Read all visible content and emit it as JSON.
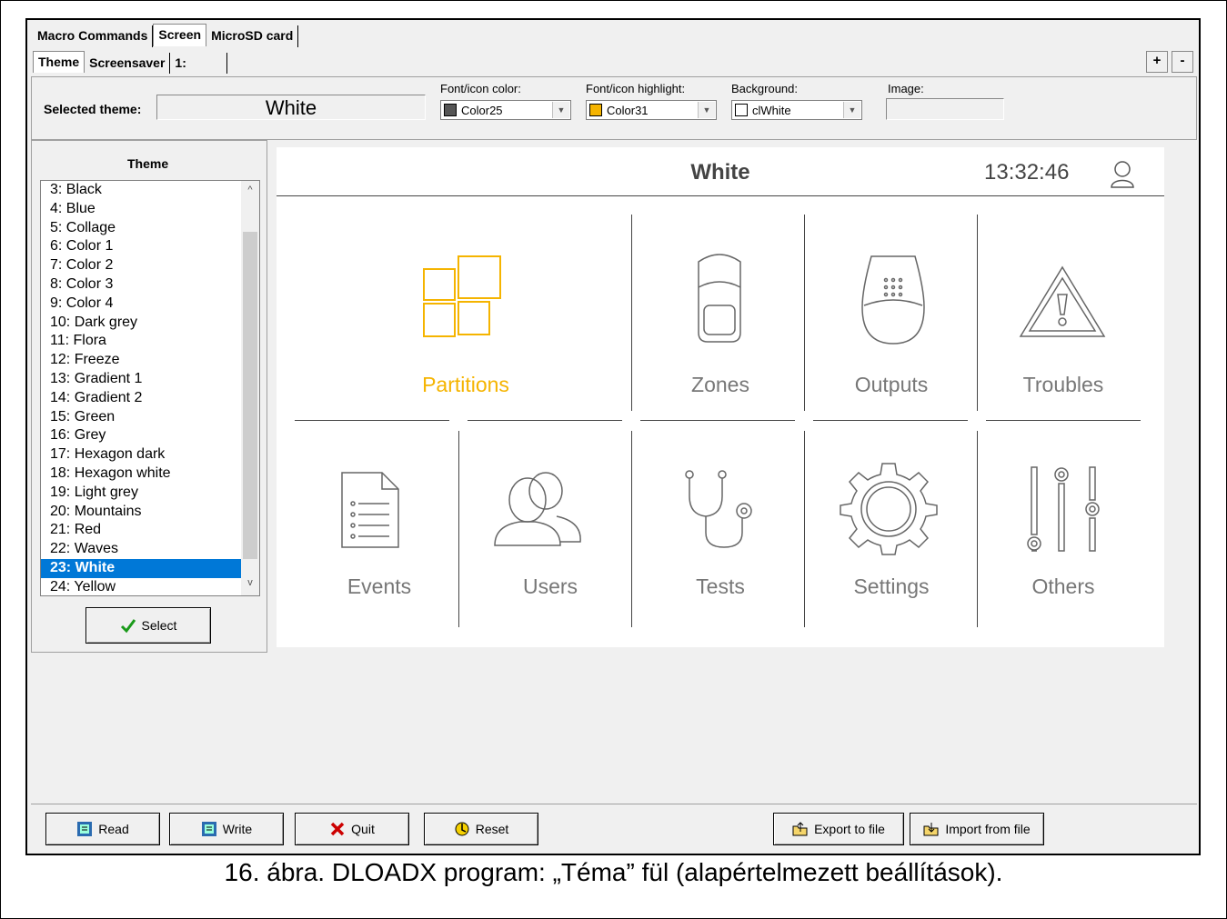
{
  "tabs_top": [
    "Macro Commands",
    "Screen",
    "MicroSD card"
  ],
  "tabs_sub": [
    "Theme",
    "Screensaver",
    "1:"
  ],
  "plus_label": "+",
  "minus_label": "-",
  "header": {
    "selected_theme_label": "Selected theme:",
    "selected_theme_value": "White",
    "font_color_label": "Font/icon color:",
    "font_color_value": "Color25",
    "font_color_swatch": "#555555",
    "highlight_label": "Font/icon highlight:",
    "highlight_value": "Color31",
    "highlight_swatch": "#f5b400",
    "background_label": "Background:",
    "background_value": "clWhite",
    "background_swatch": "#ffffff",
    "image_label": "Image:"
  },
  "theme_list": {
    "title": "Theme",
    "items": [
      "3: Black",
      "4: Blue",
      "5: Collage",
      "6: Color 1",
      "7: Color 2",
      "8: Color 3",
      "9: Color 4",
      "10: Dark grey",
      "11: Flora",
      "12: Freeze",
      "13: Gradient 1",
      "14: Gradient 2",
      "15: Green",
      "16: Grey",
      "17: Hexagon dark",
      "18: Hexagon white",
      "19: Light grey",
      "20: Mountains",
      "21: Red",
      "22: Waves",
      "23: White",
      "24: Yellow"
    ],
    "selected": "23: White",
    "select_button": "Select"
  },
  "preview": {
    "title": "White",
    "time": "13:32:46",
    "accent": "#f5b400",
    "tiles": [
      "Partitions",
      "Zones",
      "Outputs",
      "Troubles",
      "Events",
      "Users",
      "Tests",
      "Settings",
      "Others"
    ]
  },
  "buttons": {
    "read": "Read",
    "write": "Write",
    "quit": "Quit",
    "reset": "Reset",
    "export": "Export to file",
    "import": "Import from file"
  },
  "caption": "16. ábra. DLOADX program: „Téma” fül (alapértelmezett beállítások)."
}
